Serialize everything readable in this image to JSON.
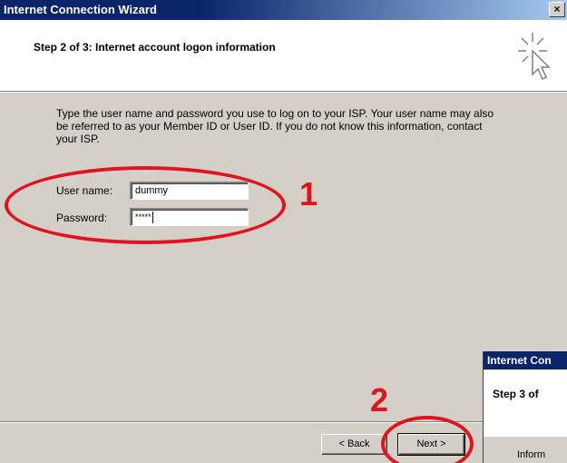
{
  "window": {
    "title": "Internet Connection Wizard",
    "close_glyph": "×"
  },
  "header": {
    "step_title": "Step 2 of 3: Internet account logon information",
    "icon": "wizard-cursor-icon"
  },
  "body": {
    "description": "Type the user name and password you use to log on to your ISP. Your user name may also be referred to as your Member ID or User ID. If you do not know this information, contact your ISP."
  },
  "form": {
    "username_label": "User name:",
    "username_value": "dummy",
    "password_label": "Password:",
    "password_value": "*****"
  },
  "annotations": {
    "one": "1",
    "two": "2",
    "color": "#e0141e"
  },
  "buttons": {
    "back_label": "< Back",
    "next_label": "Next >"
  },
  "overlay_window": {
    "title": "Internet Con",
    "step": "Step 3 of",
    "info": "Inform"
  },
  "colors": {
    "titlebar": "#0a246a",
    "dialog_bg": "#d4d0c8"
  }
}
